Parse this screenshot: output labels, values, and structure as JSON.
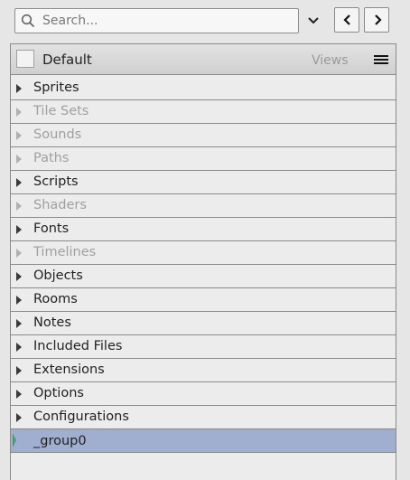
{
  "search": {
    "placeholder": "Search..."
  },
  "view": {
    "name": "Default",
    "views_label": "Views"
  },
  "tree": {
    "items": [
      {
        "label": "Sprites",
        "disabled": false
      },
      {
        "label": "Tile Sets",
        "disabled": true
      },
      {
        "label": "Sounds",
        "disabled": true
      },
      {
        "label": "Paths",
        "disabled": true
      },
      {
        "label": "Scripts",
        "disabled": false
      },
      {
        "label": "Shaders",
        "disabled": true
      },
      {
        "label": "Fonts",
        "disabled": false
      },
      {
        "label": "Timelines",
        "disabled": true
      },
      {
        "label": "Objects",
        "disabled": false
      },
      {
        "label": "Rooms",
        "disabled": false
      },
      {
        "label": "Notes",
        "disabled": false
      },
      {
        "label": "Included Files",
        "disabled": false
      },
      {
        "label": "Extensions",
        "disabled": false
      },
      {
        "label": "Options",
        "disabled": false
      },
      {
        "label": "Configurations",
        "disabled": false
      }
    ],
    "selected_group": "_group0"
  },
  "colors": {
    "selected_bg": "#a0aed0",
    "disabled_text": "#a0a0a0"
  }
}
